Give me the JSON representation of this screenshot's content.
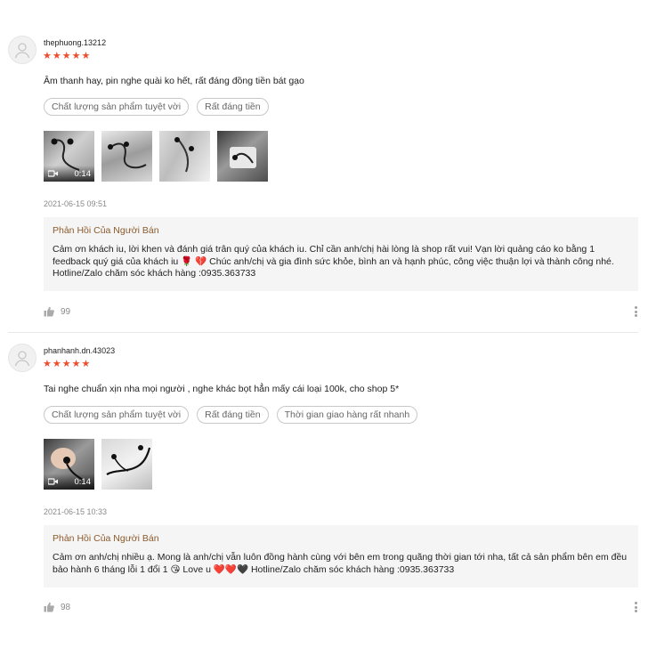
{
  "reviews": [
    {
      "username": "thephuong.13212",
      "rating_stars": "★★★★★",
      "rating": 5,
      "comment": "Âm thanh hay, pin nghe quài ko hết, rất đáng đồng tiền bát gạo",
      "tags": [
        "Chất lượng sản phẩm tuyệt vời",
        "Rất đáng tiền"
      ],
      "video_duration": "0:14",
      "date": "2021-06-15 09:51",
      "seller_reply_title": "Phản Hồi Của Người Bán",
      "seller_reply": "Cảm ơn khách iu, lời khen và đánh giá trân quý của khách iu. Chỉ cần anh/chị hài lòng là shop rất vui! Vạn lời quảng cáo ko bằng 1 feedback quý giá của khách iu 🌹 💔 Chúc anh/chị và gia đình sức khỏe, bình an và hạnh phúc, công việc thuận lợi và thành công nhé. Hotline/Zalo chăm sóc khách hàng :0935.363733",
      "likes": "99"
    },
    {
      "username": "phanhanh.dn.43023",
      "rating_stars": "★★★★★",
      "rating": 5,
      "comment": "Tai nghe chuẩn xịn nha mọi người , nghe khác bọt hẳn mấy cái loại 100k, cho shop 5*",
      "tags": [
        "Chất lượng sản phẩm tuyệt vời",
        "Rất đáng tiền",
        "Thời gian giao hàng rất nhanh"
      ],
      "video_duration": "0:14",
      "date": "2021-06-15 10:33",
      "seller_reply_title": "Phản Hồi Của Người Bán",
      "seller_reply": "Cảm ơn anh/chị nhiều ạ. Mong là anh/chị vẫn luôn đồng hành cùng với bên em trong quãng thời gian tới nha, tất cả sản phẩm bên em đều bảo hành 6 tháng lỗi 1 đổi 1 😘 Love u ❤️❤️🖤 Hotline/Zalo chăm sóc khách hàng :0935.363733",
      "likes": "98"
    }
  ],
  "icons": {
    "star": "star-icon",
    "like": "thumbs-up-icon",
    "more": "more-vertical-icon",
    "video": "video-camera-icon",
    "avatar": "user-avatar-icon"
  },
  "colors": {
    "star": "#ee4d2d",
    "reply_title": "#8b5a2b",
    "reply_bg": "#f5f5f5",
    "muted": "#8a8a8a"
  }
}
